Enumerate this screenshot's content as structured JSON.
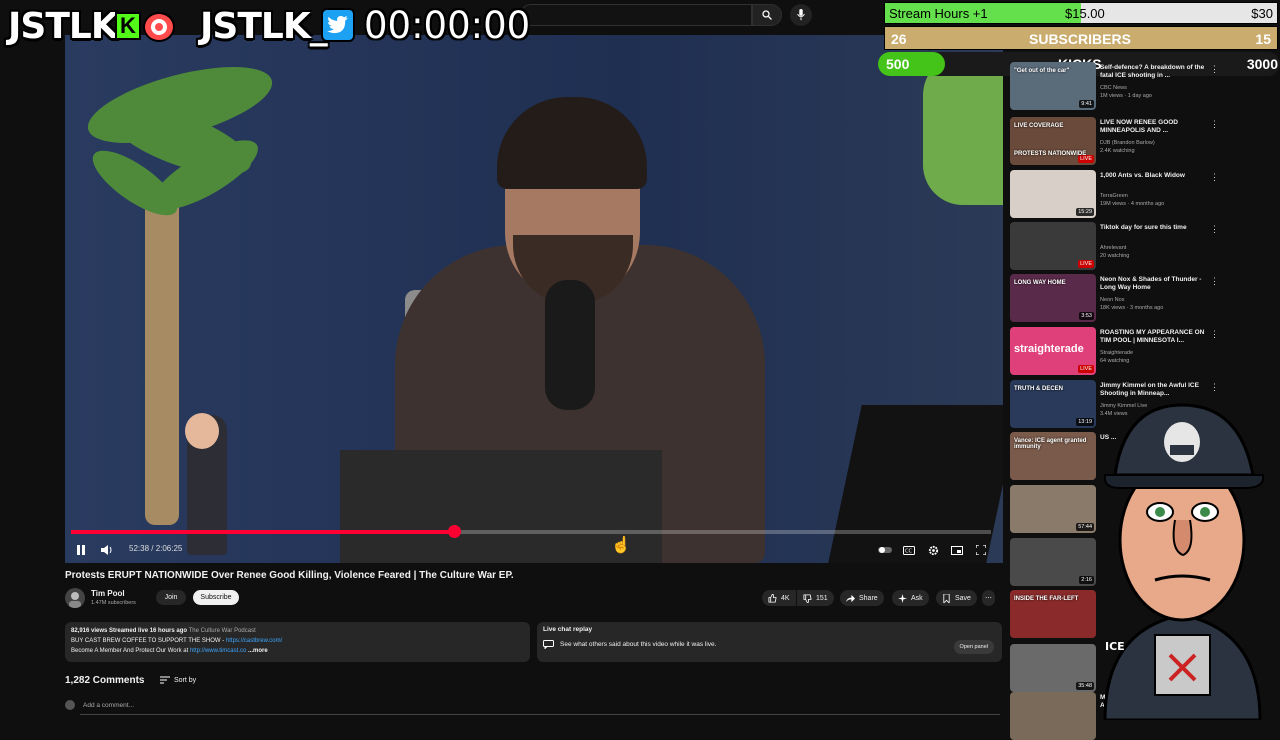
{
  "overlay": {
    "logo_left": "JSTLK",
    "kick_letter": "K",
    "logo_right": "JSTLK_",
    "timer": "00:00:00",
    "goal_stream_hours": {
      "label": "Stream Hours +1",
      "current": "$15.00",
      "target": "$30",
      "progress": 0.5
    },
    "goal_subscribers": {
      "left": "26",
      "label": "SUBSCRIBERS",
      "right": "15"
    },
    "goal_kicks": {
      "left": "500",
      "label": "KICKS",
      "right": "3000",
      "progress": 0.167
    },
    "accent_green": "#53fc18"
  },
  "player": {
    "time": "52:38 / 2:06:25",
    "progress": 0.416
  },
  "video": {
    "title": "Protests ERUPT NATIONWIDE Over Renee Good Killing, Violence Feared | The Culture War EP.",
    "channel": "Tim Pool",
    "subscribers": "1.47M subscribers",
    "join_label": "Join",
    "subscribe_label": "Subscribe",
    "likes": "4K",
    "dislikes": "151",
    "share_label": "Share",
    "ask_label": "Ask",
    "save_label": "Save"
  },
  "description": {
    "stats": "82,916 views  Streamed live 16 hours ago",
    "tag": "The Culture War Podcast",
    "line1_text": "BUY CAST BREW COFFEE TO SUPPORT THE SHOW - ",
    "line1_link": "https://castbrew.com/",
    "line2_text": "Become A Member And Protect Our Work at ",
    "line2_link": "http://www.timcast.co",
    "more": "...more"
  },
  "live_chat": {
    "title": "Live chat replay",
    "text": "See what others said about this video while it was live.",
    "button": "Open panel"
  },
  "comments": {
    "count": "1,282 Comments",
    "sort_label": "Sort by",
    "placeholder": "Add a comment..."
  },
  "recommendations": [
    {
      "title": "Self-defence? A breakdown of the fatal ICE shooting in ...",
      "channel": "CBC News",
      "meta": "1M views · 1 day ago",
      "badge": "9:41",
      "live": false,
      "color": "#5a6b7a"
    },
    {
      "title": "LIVE NOW RENEE GOOD MINNEAPOLIS AND ...",
      "channel": "DJB (Brandon Barlow)",
      "meta": "2.4K watching",
      "badge": "LIVE",
      "live": true,
      "color": "#6a4a3a"
    },
    {
      "title": "1,000 Ants vs. Black Widow",
      "channel": "TerraGreen",
      "meta": "19M views · 4 months ago",
      "badge": "15:29",
      "live": false,
      "color": "#d8d0c8"
    },
    {
      "title": "Tiktok day for sure this time",
      "channel": "Ahrelevant",
      "meta": "20 watching",
      "badge": "LIVE",
      "live": true,
      "color": "#3a3a3a"
    },
    {
      "title": "Neon Nox & Shades of Thunder - Long Way Home",
      "channel": "Neon Nox",
      "meta": "18K views · 3 months ago",
      "badge": "3:53",
      "live": false,
      "color": "#5a2a4a"
    },
    {
      "title": "ROASTING MY APPEARANCE ON TIM POOL | MINNESOTA I...",
      "channel": "Straighterade",
      "meta": "64 watching",
      "badge": "LIVE",
      "live": true,
      "color": "#e0407a"
    },
    {
      "title": "Jimmy Kimmel on the Awful ICE Shooting in Minneap...",
      "channel": "Jimmy Kimmel Live",
      "meta": "3.4M views",
      "badge": "13:19",
      "live": false,
      "color": "#2a3a5a"
    },
    {
      "title": "US ...",
      "channel": "",
      "meta": "",
      "badge": "",
      "live": false,
      "color": "#7a5a4a"
    },
    {
      "title": "",
      "channel": "",
      "meta": "",
      "badge": "57:44",
      "live": false,
      "color": "#8a7a6a"
    },
    {
      "title": "",
      "channel": "",
      "meta": "",
      "badge": "2:16",
      "live": false,
      "color": "#4a4a4a"
    },
    {
      "title": "",
      "channel": "",
      "meta": "",
      "badge": "",
      "live": false,
      "color": "#8a2a2a"
    },
    {
      "title": "",
      "channel": "",
      "meta": "",
      "badge": "35:48",
      "live": false,
      "color": "#6a6a6a"
    },
    {
      "title": "More Incriminating Footage Of ICE Agent Murdering Mom",
      "channel": "",
      "meta": "",
      "badge": "",
      "live": false,
      "color": "#7a6a5a"
    }
  ],
  "thumb_texts": {
    "r0": "\"Get out of the car\"",
    "r1": "LIVE COVERAGE",
    "r1b": "PROTESTS NATIONWIDE",
    "r4": "LONG WAY HOME",
    "r5": "straighterade",
    "r6": "TRUTH & DECEN",
    "r7": "Vance: ICE agent granted immunity",
    "r10": "INSIDE THE FAR-LEFT"
  }
}
